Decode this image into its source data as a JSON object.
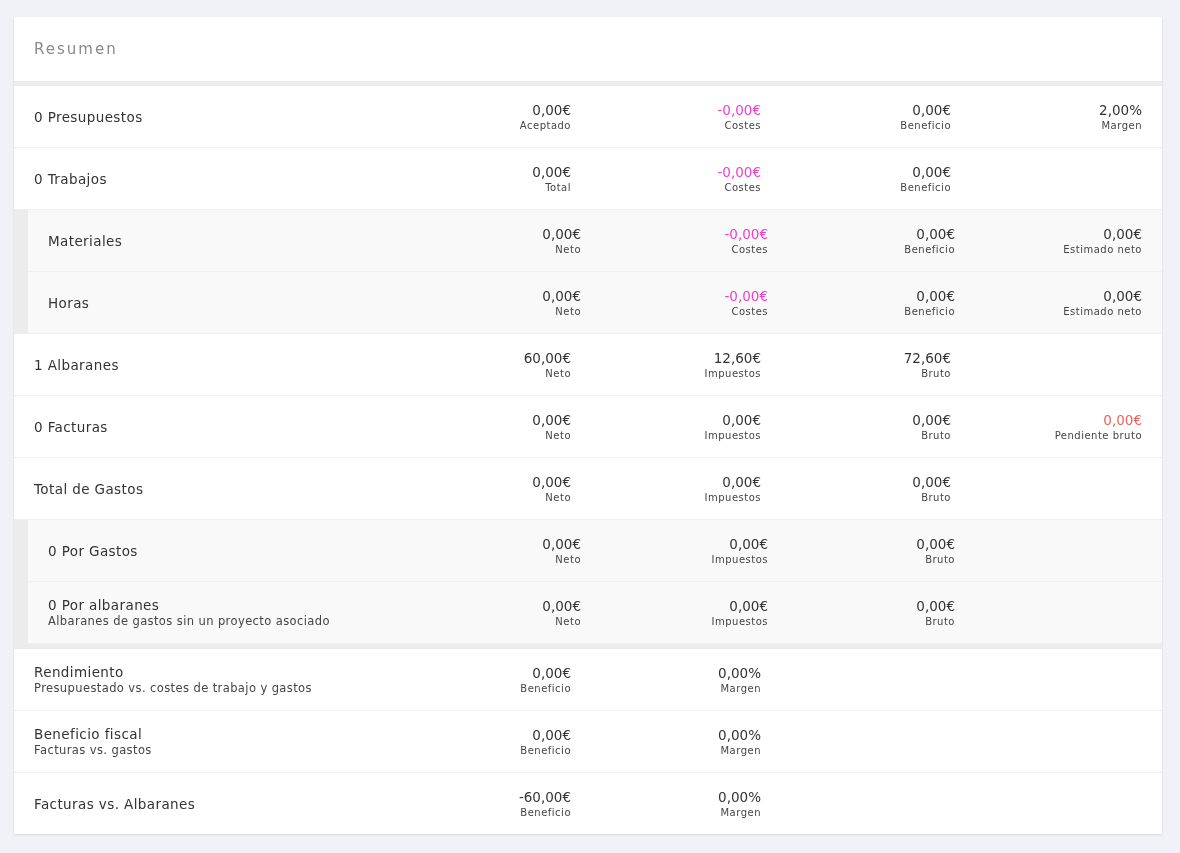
{
  "card": {
    "title": "Resumen"
  },
  "sections": [
    {
      "rows": [
        {
          "title": "0 Presupuestos",
          "values": [
            {
              "value": "0,00€",
              "label": "Aceptado",
              "color": "#333333"
            },
            {
              "value": "-0,00€",
              "label": "Costes",
              "color": "#ec3fd0"
            },
            {
              "value": "0,00€",
              "label": "Beneficio",
              "color": "#333333"
            },
            {
              "value": "2,00%",
              "label": "Margen",
              "color": "#333333"
            }
          ]
        },
        {
          "title": "0 Trabajos",
          "values": [
            {
              "value": "0,00€",
              "label": "Total",
              "color": "#333333"
            },
            {
              "value": "-0,00€",
              "label": "Costes",
              "color": "#ec3fd0"
            },
            {
              "value": "0,00€",
              "label": "Beneficio",
              "color": "#333333"
            }
          ],
          "children": [
            {
              "title": "Materiales",
              "values": [
                {
                  "value": "0,00€",
                  "label": "Neto",
                  "color": "#333333"
                },
                {
                  "value": "-0,00€",
                  "label": "Costes",
                  "color": "#ec3fd0"
                },
                {
                  "value": "0,00€",
                  "label": "Beneficio",
                  "color": "#333333"
                },
                {
                  "value": "0,00€",
                  "label": "Estimado neto",
                  "color": "#333333"
                }
              ]
            },
            {
              "title": "Horas",
              "values": [
                {
                  "value": "0,00€",
                  "label": "Neto",
                  "color": "#333333"
                },
                {
                  "value": "-0,00€",
                  "label": "Costes",
                  "color": "#ec3fd0"
                },
                {
                  "value": "0,00€",
                  "label": "Beneficio",
                  "color": "#333333"
                },
                {
                  "value": "0,00€",
                  "label": "Estimado neto",
                  "color": "#333333"
                }
              ]
            }
          ]
        },
        {
          "title": "1 Albaranes",
          "values": [
            {
              "value": "60,00€",
              "label": "Neto",
              "color": "#333333"
            },
            {
              "value": "12,60€",
              "label": "Impuestos",
              "color": "#333333"
            },
            {
              "value": "72,60€",
              "label": "Bruto",
              "color": "#333333"
            }
          ]
        },
        {
          "title": "0 Facturas",
          "values": [
            {
              "value": "0,00€",
              "label": "Neto",
              "color": "#333333"
            },
            {
              "value": "0,00€",
              "label": "Impuestos",
              "color": "#333333"
            },
            {
              "value": "0,00€",
              "label": "Bruto",
              "color": "#333333"
            },
            {
              "value": "0,00€",
              "label": "Pendiente bruto",
              "color": "#f0605a"
            }
          ]
        },
        {
          "title": "Total de Gastos",
          "values": [
            {
              "value": "0,00€",
              "label": "Neto",
              "color": "#333333"
            },
            {
              "value": "0,00€",
              "label": "Impuestos",
              "color": "#333333"
            },
            {
              "value": "0,00€",
              "label": "Bruto",
              "color": "#333333"
            }
          ],
          "children": [
            {
              "title": "0 Por Gastos",
              "values": [
                {
                  "value": "0,00€",
                  "label": "Neto",
                  "color": "#333333"
                },
                {
                  "value": "0,00€",
                  "label": "Impuestos",
                  "color": "#333333"
                },
                {
                  "value": "0,00€",
                  "label": "Bruto",
                  "color": "#333333"
                }
              ]
            },
            {
              "title": "0 Por albaranes",
              "subtitle": "Albaranes de gastos sin un proyecto asociado",
              "values": [
                {
                  "value": "0,00€",
                  "label": "Neto",
                  "color": "#333333"
                },
                {
                  "value": "0,00€",
                  "label": "Impuestos",
                  "color": "#333333"
                },
                {
                  "value": "0,00€",
                  "label": "Bruto",
                  "color": "#333333"
                }
              ]
            }
          ]
        }
      ]
    },
    {
      "rows": [
        {
          "title": "Rendimiento",
          "subtitle": "Presupuestado vs. costes de trabajo y gastos",
          "values": [
            {
              "value": "0,00€",
              "label": "Beneficio",
              "color": "#333333"
            },
            {
              "value": "0,00%",
              "label": "Margen",
              "color": "#333333"
            }
          ]
        },
        {
          "title": "Beneficio fiscal",
          "subtitle": "Facturas vs. gastos",
          "values": [
            {
              "value": "0,00€",
              "label": "Beneficio",
              "color": "#333333"
            },
            {
              "value": "0,00%",
              "label": "Margen",
              "color": "#333333"
            }
          ]
        },
        {
          "title": "Facturas vs. Albaranes",
          "values": [
            {
              "value": "-60,00€",
              "label": "Beneficio",
              "color": "#333333"
            },
            {
              "value": "0,00%",
              "label": "Margen",
              "color": "#333333"
            }
          ]
        }
      ]
    }
  ]
}
